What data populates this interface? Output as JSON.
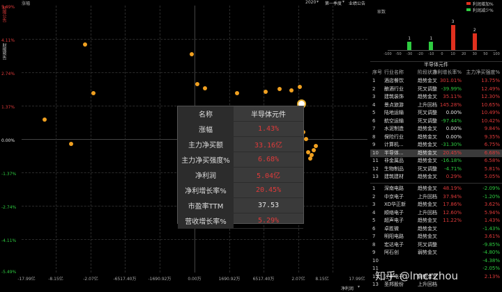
{
  "topbar": {
    "left_label": "涨幅",
    "year_select": "2020",
    "quarter_select": "第一季度",
    "announce_button": "业绩公告"
  },
  "left_tabs": [
    "财报公告",
    "财报预告"
  ],
  "chart_data": {
    "type": "scatter",
    "y_ticks": [
      "5.49%",
      "4.11%",
      "2.74%",
      "1.37%",
      "0.00%",
      "-1.37%",
      "-2.74%",
      "-4.11%",
      "-5.49%"
    ],
    "x_ticks": [
      "-17.99亿",
      "-8.15亿",
      "-2.07亿",
      "-6517.40万",
      "-1690.92万",
      "0.00万",
      "1690.92万",
      "6517.40万",
      "2.07亿",
      "8.15亿",
      "17.99亿"
    ],
    "points": [
      {
        "x": -12.0,
        "y": 0.8
      },
      {
        "x": -5.5,
        "y": -0.2
      },
      {
        "x": -3.1,
        "y": 3.9
      },
      {
        "x": -1.95,
        "y": 1.9
      },
      {
        "x": -0.015,
        "y": 3.5
      },
      {
        "x": 0.012,
        "y": 2.25
      },
      {
        "x": 0.05,
        "y": 2.1
      },
      {
        "x": 0.28,
        "y": 1.9
      },
      {
        "x": 0.75,
        "y": 1.95
      },
      {
        "x": 1.3,
        "y": 2.05
      },
      {
        "x": 1.8,
        "y": 2.0
      },
      {
        "x": 2.4,
        "y": 2.15
      },
      {
        "x": 2.9,
        "y": 1.43,
        "highlight": true
      },
      {
        "x": 3.3,
        "y": 0.3
      },
      {
        "x": 4.0,
        "y": 0.0
      },
      {
        "x": 4.5,
        "y": -0.55
      },
      {
        "x": 5.1,
        "y": -0.8
      },
      {
        "x": 5.5,
        "y": -0.65
      },
      {
        "x": 6.0,
        "y": -0.45
      },
      {
        "x": 6.6,
        "y": -0.3
      }
    ],
    "grid": true,
    "legend": "none"
  },
  "tooltip": {
    "header_key": "名称",
    "header_value": "半导体元件",
    "rows": [
      {
        "k": "涨幅",
        "v": "1.43%",
        "c": "red"
      },
      {
        "k": "主力净买额",
        "v": "33.16亿",
        "c": "red"
      },
      {
        "k": "主力净买强度%",
        "v": "6.68%",
        "c": "red"
      },
      {
        "k": "净利润",
        "v": "5.04亿",
        "c": "red"
      },
      {
        "k": "净利增长率%",
        "v": "20.45%",
        "c": "red"
      },
      {
        "k": "市盈率TTM",
        "v": "37.53",
        "c": "white"
      },
      {
        "k": "营收增长率%",
        "v": "5.29%",
        "c": "red"
      }
    ]
  },
  "bottom_bar": {
    "select_label": "净利润"
  },
  "histogram": {
    "title": "家数",
    "legend_up": "利润增加%",
    "legend_down": "利润减少%",
    "colors": {
      "up": "#e0301e",
      "down": "#2ecc40"
    },
    "ticks": [
      "-100",
      "-50",
      "-30",
      "-20",
      "-10",
      "0",
      "10",
      "20",
      "30",
      "50",
      "100"
    ],
    "bars": [
      {
        "pos": 2,
        "value": 1,
        "color": "down"
      },
      {
        "pos": 4,
        "value": 1,
        "color": "down"
      },
      {
        "pos": 6,
        "value": 3,
        "color": "up"
      },
      {
        "pos": 8,
        "value": 2,
        "color": "up"
      }
    ]
  },
  "industry_title": "半导体元件",
  "table_headers": [
    "序号",
    "行业名称",
    "阶段状态",
    "净利增长率%",
    "主力净买强度%"
  ],
  "industry_rows": [
    {
      "i": "1",
      "n": "酒店餐饮",
      "s": "趋势金叉",
      "a": "301.01%",
      "ac": "red",
      "b": "13.75%",
      "bc": "red"
    },
    {
      "i": "2",
      "n": "酿酒行业",
      "s": "死叉调整",
      "a": "-39.99%",
      "ac": "green",
      "b": "12.49%",
      "bc": "red"
    },
    {
      "i": "3",
      "n": "建筑装饰",
      "s": "趋势金叉",
      "a": "35.11%",
      "ac": "red",
      "b": "12.30%",
      "bc": "red"
    },
    {
      "i": "4",
      "n": "景点旅游",
      "s": "上升回档",
      "a": "145.28%",
      "ac": "red",
      "b": "10.65%",
      "bc": "red"
    },
    {
      "i": "5",
      "n": "陆地运输",
      "s": "死叉调整",
      "a": "0.00%",
      "ac": "white",
      "b": "10.49%",
      "bc": "red"
    },
    {
      "i": "6",
      "n": "航空运输",
      "s": "死叉调整",
      "a": "-97.44%",
      "ac": "green",
      "b": "10.42%",
      "bc": "red"
    },
    {
      "i": "7",
      "n": "水泥制造",
      "s": "趋势金叉",
      "a": "0.00%",
      "ac": "white",
      "b": "9.84%",
      "bc": "red"
    },
    {
      "i": "8",
      "n": "保险行业",
      "s": "趋势金叉",
      "a": "0.00%",
      "ac": "white",
      "b": "9.35%",
      "bc": "red"
    },
    {
      "i": "9",
      "n": "计算机...",
      "s": "趋势金叉",
      "a": "-31.30%",
      "ac": "green",
      "b": "6.75%",
      "bc": "red"
    },
    {
      "i": "10",
      "n": "半导体...",
      "s": "趋势金叉",
      "a": "20.45%",
      "ac": "red",
      "b": "6.68%",
      "bc": "red",
      "selected": true
    },
    {
      "i": "11",
      "n": "非金属品",
      "s": "趋势金叉",
      "a": "-16.18%",
      "ac": "green",
      "b": "6.58%",
      "bc": "red"
    },
    {
      "i": "12",
      "n": "生物制品",
      "s": "死叉调整",
      "a": "-4.71%",
      "ac": "green",
      "b": "5.81%",
      "bc": "red"
    },
    {
      "i": "13",
      "n": "建筑建材",
      "s": "趋势金叉",
      "a": "0.29%",
      "ac": "red",
      "b": "5.05%",
      "bc": "red"
    }
  ],
  "stock_rows": [
    {
      "i": "1",
      "n": "深南电路",
      "s": "趋势金叉",
      "a": "48.19%",
      "ac": "red",
      "b": "-2.09%",
      "bc": "green"
    },
    {
      "i": "2",
      "n": "中京电子",
      "s": "上升回档",
      "a": "37.94%",
      "ac": "red",
      "b": "-1.20%",
      "bc": "green"
    },
    {
      "i": "3",
      "n": "XD华正新",
      "s": "趋势金叉",
      "a": "17.86%",
      "ac": "red",
      "b": "3.62%",
      "bc": "red"
    },
    {
      "i": "4",
      "n": "顺络电子",
      "s": "上升回档",
      "a": "12.60%",
      "ac": "red",
      "b": "5.94%",
      "bc": "red"
    },
    {
      "i": "5",
      "n": "超声电子",
      "s": "趋势金叉",
      "a": "11.22%",
      "ac": "red",
      "b": "1.43%",
      "bc": "red"
    },
    {
      "i": "6",
      "n": "卓胜微",
      "s": "趋势金叉",
      "a": "",
      "ac": "white",
      "b": "-1.43%",
      "bc": "green"
    },
    {
      "i": "7",
      "n": "明阳电路",
      "s": "趋势金叉",
      "a": "",
      "ac": "white",
      "b": "3.61%",
      "bc": "red"
    },
    {
      "i": "8",
      "n": "宏达电子",
      "s": "死叉调整",
      "a": "",
      "ac": "white",
      "b": "-9.85%",
      "bc": "green"
    },
    {
      "i": "9",
      "n": "阿石创",
      "s": "弱势金叉",
      "a": "",
      "ac": "white",
      "b": "-4.80%",
      "bc": "green"
    },
    {
      "i": "10",
      "n": "",
      "s": "",
      "a": "",
      "ac": "white",
      "b": "-4.38%",
      "bc": "green"
    },
    {
      "i": "11",
      "n": "",
      "s": "",
      "a": "",
      "ac": "white",
      "b": "-2.05%",
      "bc": "green"
    },
    {
      "i": "12",
      "n": "江丰电子",
      "s": "弱势金叉",
      "a": "",
      "ac": "white",
      "b": "2.13%",
      "bc": "red"
    },
    {
      "i": "13",
      "n": "圣邦股份",
      "s": "上升回档",
      "a": "",
      "ac": "white",
      "b": "",
      "bc": "white"
    }
  ],
  "watermark": "知乎 @lmcrzhou"
}
